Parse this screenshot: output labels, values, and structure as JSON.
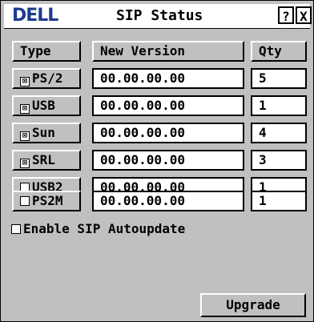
{
  "brand": "DELL",
  "window": {
    "title": "SIP Status",
    "help_label": "?",
    "close_label": "X"
  },
  "table": {
    "headers": {
      "type": "Type",
      "version": "New Version",
      "qty": "Qty"
    },
    "rows": [
      {
        "type": "PS/2",
        "version": "00.00.00.00",
        "qty": "5",
        "checked": true
      },
      {
        "type": "USB",
        "version": "00.00.00.00",
        "qty": "1",
        "checked": true
      },
      {
        "type": "Sun",
        "version": "00.00.00.00",
        "qty": "4",
        "checked": true
      },
      {
        "type": "SRL",
        "version": "00.00.00.00",
        "qty": "3",
        "checked": true
      },
      {
        "type": "USB2",
        "version": "00.00.00.00",
        "qty": "1",
        "checked": false
      },
      {
        "type": "PS2M",
        "version": "00.00.00.00",
        "qty": "1",
        "checked": false
      }
    ]
  },
  "autoupdate": {
    "label": "Enable SIP Autoupdate",
    "checked": false
  },
  "upgrade_label": "Upgrade"
}
